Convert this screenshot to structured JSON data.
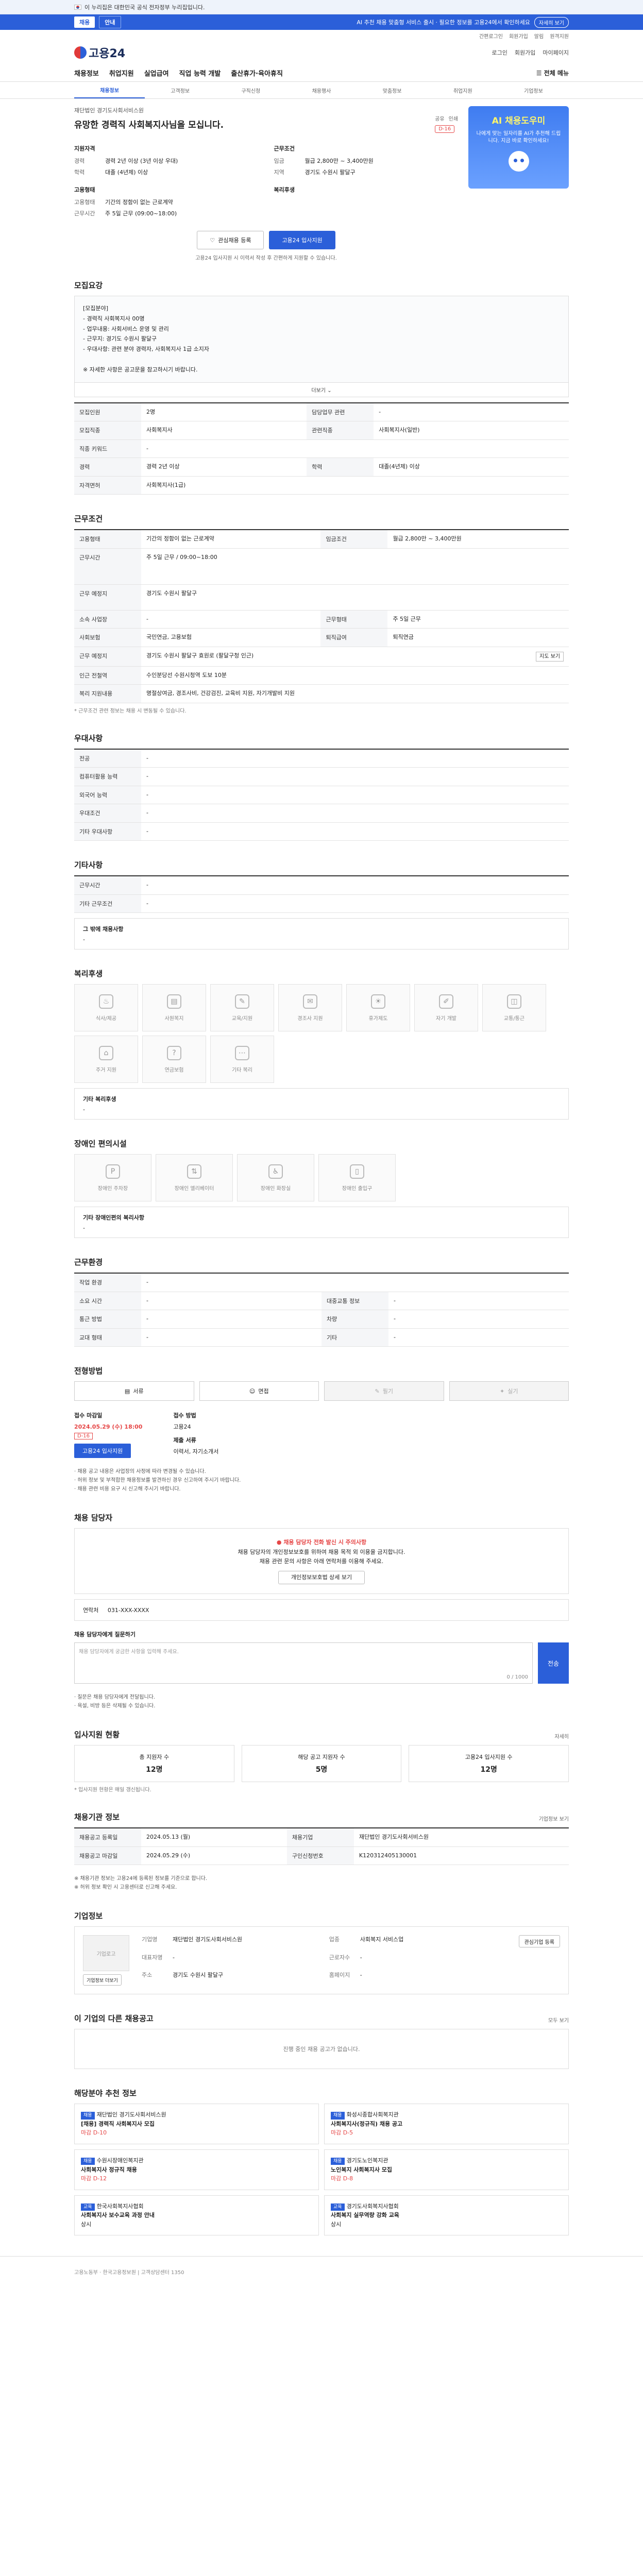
{
  "gov": {
    "text": "이 누리집은 대한민국 공식 전자정부 누리집입니다."
  },
  "notice": {
    "tab1": "채용",
    "tab2": "안내",
    "text": "AI 추천 채용 맞춤형 서비스 출시 · 필요한 정보를 고용24에서 확인하세요",
    "more": "자세히 보기"
  },
  "util": [
    "간편로그인",
    "회원가입",
    "알림",
    "원격지원"
  ],
  "header": {
    "logo": "고용24",
    "links": [
      "로그인",
      "회원가입",
      "마이페이지"
    ]
  },
  "gnb": {
    "menus": [
      "채용정보",
      "취업지원",
      "실업급여",
      "직업 능력 개발",
      "출산휴가·육아휴직"
    ],
    "all_menu": "전체 메뉴"
  },
  "subnav": [
    "채용정보",
    "고객정보",
    "구직신청",
    "채용행사",
    "맞춤정보",
    "취업지원",
    "기업정보"
  ],
  "job": {
    "company": "재단법인 경기도사회서비스원",
    "title": "유망한 경력직 사회복지사님을 모십니다.",
    "share": "공유",
    "print": "인쇄",
    "dday": "D-16",
    "qualification_head": "지원자격",
    "career_label": "경력",
    "career_value": "경력 2년 이상 (3년 이상 우대)",
    "edu_label": "학력",
    "edu_value": "대졸 (4년제) 이상",
    "cond_head": "근무조건",
    "pay_label": "임금",
    "pay_value": "월급 2,800만 ~ 3,400만원",
    "region_label": "지역",
    "region_value": "경기도 수원시 팔달구",
    "emp_head": "고용형태",
    "emp_type_label": "고용형태",
    "emp_type_value": "기간의 정함이 없는 근로계약",
    "work_time_label": "근무시간",
    "work_time_value": "주 5일 근무 (09:00~18:00)",
    "other_head": "복리후생",
    "scrap_btn": "관심채용 등록",
    "apply_btn": "고용24 입사지원",
    "apply_note": "고용24 입사지원 시 이력서 작성 후 간편하게 지원할 수 있습니다."
  },
  "ad": {
    "title": "AI 채용도우미",
    "sub": "나에게 맞는 일자리를 AI가 추천해 드립니다. 지금 바로 확인하세요!"
  },
  "sections": {
    "recruit": {
      "title": "모집요강",
      "body": [
        "[모집분야]",
        "- 경력직 사회복지사 00명",
        "- 업무내용: 사회서비스 운영 및 관리",
        "- 근무지: 경기도 수원시 팔달구",
        "- 우대사항: 관련 분야 경력자, 사회복지사 1급 소지자",
        "",
        "※ 자세한 사항은 공고문을 참고하시기 바랍니다."
      ],
      "more": "더보기"
    },
    "basic": {
      "rows": [
        [
          "모집인원",
          "2명",
          "담당업무 관련",
          "-"
        ],
        [
          "모집직종",
          "사회복지사",
          "관련직종",
          "사회복지사(일반)"
        ],
        [
          "직종 키워드",
          "-",
          "",
          ""
        ],
        [
          "경력",
          "경력 2년 이상",
          "학력",
          "대졸(4년제) 이상"
        ],
        [
          "자격면허",
          "사회복지사(1급)",
          "",
          ""
        ]
      ]
    },
    "cond": {
      "title": "근무조건",
      "rows": [
        [
          "고용형태",
          "기간의 정함이 없는 근로계약",
          "임금조건",
          "월급 2,800만 ~ 3,400만원"
        ],
        [
          "근무시간",
          "주 5일 근무 / 09:00~18:00",
          "",
          ""
        ],
        [
          "근무 예정지",
          "경기도 수원시 팔달구",
          "",
          ""
        ],
        [
          "소속 사업장",
          "-",
          "근무형태",
          "주 5일 근무"
        ],
        [
          "사회보험",
          "국민연금, 고용보험",
          "퇴직급여",
          "퇴직연금"
        ],
        [
          "근무 예정지",
          "경기도 수원시 팔달구 효원로 (팔달구청 인근)",
          "",
          ""
        ],
        [
          "인근 전철역",
          "수인분당선 수원시청역 도보 10분",
          "",
          ""
        ],
        [
          "복리 지원내용",
          "명절상여금, 경조사비, 건강검진, 교육비 지원, 자기개발비 지원",
          "",
          ""
        ]
      ],
      "map_btn": "지도 보기",
      "note": "* 근무조건 관련 정보는 채용 시 변동될 수 있습니다."
    },
    "pref": {
      "title": "우대사항",
      "rows": [
        [
          "전공",
          "-"
        ],
        [
          "컴퓨터활용 능력",
          "-"
        ],
        [
          "외국어 능력",
          "-"
        ],
        [
          "우대조건",
          "-"
        ],
        [
          "기타 우대사항",
          "-"
        ]
      ]
    },
    "etc": {
      "title": "기타사항",
      "rows": [
        [
          "근무시간",
          "-"
        ],
        [
          "기타 근무조건",
          "-"
        ]
      ],
      "box_title": "그 밖에 채용사항",
      "box_value": "-"
    },
    "welfare": {
      "title": "복리후생",
      "tiles": [
        "식사/제공",
        "사원복지",
        "교육/지원",
        "경조사 지원",
        "휴가제도",
        "자기 개발",
        "교통/통근",
        "주거 지원",
        "연금보험",
        "기타 복리"
      ],
      "box_title": "기타 복리후생",
      "box_value": "-"
    },
    "disabled": {
      "title": "장애인 편의시설",
      "tiles": [
        "장애인 주차장",
        "장애인 엘리베이터",
        "장애인 화장실",
        "장애인 출입구"
      ],
      "box_title": "기타 장애인편의 복리사항",
      "box_value": "-"
    },
    "worker": {
      "title": "근무환경",
      "rows": [
        [
          "작업 환경",
          "-",
          "",
          ""
        ],
        [
          "소요 시간",
          "-",
          "대중교통 정보",
          "-"
        ],
        [
          "통근 방법",
          "-",
          "차량",
          "-"
        ],
        [
          "교대 형태",
          "-",
          "기타",
          "-"
        ]
      ]
    },
    "method": {
      "title": "전형방법",
      "items": [
        "서류",
        "면접",
        "필기",
        "실기"
      ],
      "deadline_label": "접수 마감일",
      "deadline_value": "2024.05.29 (수) 18:00",
      "dday": "D-16",
      "apply_btn": "고용24 입사지원",
      "method_label": "접수 방법",
      "method_value": "고용24",
      "docs_label": "제출 서류",
      "docs_value": "이력서, 자기소개서",
      "notes": [
        "· 채용 공고 내용은 사업장의 사정에 따라 변경될 수 있습니다.",
        "· 허위 정보 및 부적합한 채용정보를 발견하신 경우 신고하여 주시기 바랍니다.",
        "· 채용 관련 비용 요구 시 신고해 주시기 바랍니다."
      ]
    },
    "contact": {
      "title": "채용 담당자",
      "warn": "채용 담당자 전화 발신 시 주의사항",
      "line1": "채용 담당자의 개인정보보호를 위하여 채용 목적 외 이용을 금지합니다.",
      "line2": "채용 관련 문의 사항은 아래 연락처를 이용해 주세요.",
      "btn": "개인정보보호법 상세 보기",
      "tel_label": "연락처",
      "tel_value": "031-XXX-XXXX",
      "q_title": "채용 담당자에게 질문하기",
      "q_placeholder": "채용 담당자에게 궁금한 사항을 입력해 주세요.",
      "q_count": "0 / 1000",
      "q_btn": "전송",
      "q_notes": [
        "· 질문은 채용 담당자에게 전달됩니다.",
        "· 욕설, 비방 등은 삭제될 수 있습니다."
      ]
    },
    "stats": {
      "title": "입사지원 현황",
      "aside": "자세히",
      "items": [
        [
          "총 지원자 수",
          "12명"
        ],
        [
          "해당 공고 지원자 수",
          "5명"
        ],
        [
          "고용24 입사지원 수",
          "12명"
        ]
      ],
      "note": "* 입사지원 현황은 매일 갱신됩니다."
    },
    "rec_info": {
      "title": "채용기관 정보",
      "aside": "기업정보 보기",
      "rows": [
        [
          "채용공고 등록일",
          "2024.05.13 (월)",
          "채용기업",
          "재단법인 경기도사회서비스원"
        ],
        [
          "채용공고 마감일",
          "2024.05.29 (수)",
          "구인신청번호",
          "K120312405130001"
        ]
      ],
      "notes": [
        "※ 채용기관 정보는 고용24에 등록된 정보를 기준으로 합니다.",
        "※ 허위 정보 확인 시 고용센터로 신고해 주세요."
      ]
    },
    "company": {
      "title": "기업정보",
      "logo": "기업로고",
      "rows": [
        [
          "기업명",
          "재단법인 경기도사회서비스원"
        ],
        [
          "업종",
          "사회복지 서비스업"
        ],
        [
          "대표자명",
          "-"
        ],
        [
          "근로자수",
          "-"
        ],
        [
          "주소",
          "경기도 수원시 팔달구"
        ],
        [
          "홈페이지",
          "-"
        ]
      ],
      "btn1": "기업정보 더보기",
      "btn2": "관심기업 등록"
    },
    "other_jobs": {
      "title": "이 기업의 다른 채용공고",
      "aside": "모두 보기",
      "empty": "진행 중인 채용 공고가 없습니다."
    },
    "recommend": {
      "title": "해당분야 추천 정보",
      "items": [
        [
          "채용",
          "재단법인 경기도사회서비스원",
          "[채용] 경력직 사회복지사 모집",
          "마감 D-10"
        ],
        [
          "채용",
          "화성시종합사회복지관",
          "사회복지사(정규직) 채용 공고",
          "마감 D-5"
        ],
        [
          "채용",
          "수원시장애인복지관",
          "사회복지사 정규직 채용",
          "마감 D-12"
        ],
        [
          "채용",
          "경기도노인복지관",
          "노인복지 사회복지사 모집",
          "마감 D-8"
        ],
        [
          "교육",
          "한국사회복지사협회",
          "사회복지사 보수교육 과정 안내",
          "상시"
        ],
        [
          "교육",
          "경기도사회복지사협회",
          "사회복지 실무역량 강화 교육",
          "상시"
        ]
      ]
    }
  },
  "footer": {
    "text": "고용노동부 · 한국고용정보원 | 고객상담센터 1350"
  },
  "colors": {
    "accent": "#2b5fd9",
    "danger": "#e64646"
  }
}
